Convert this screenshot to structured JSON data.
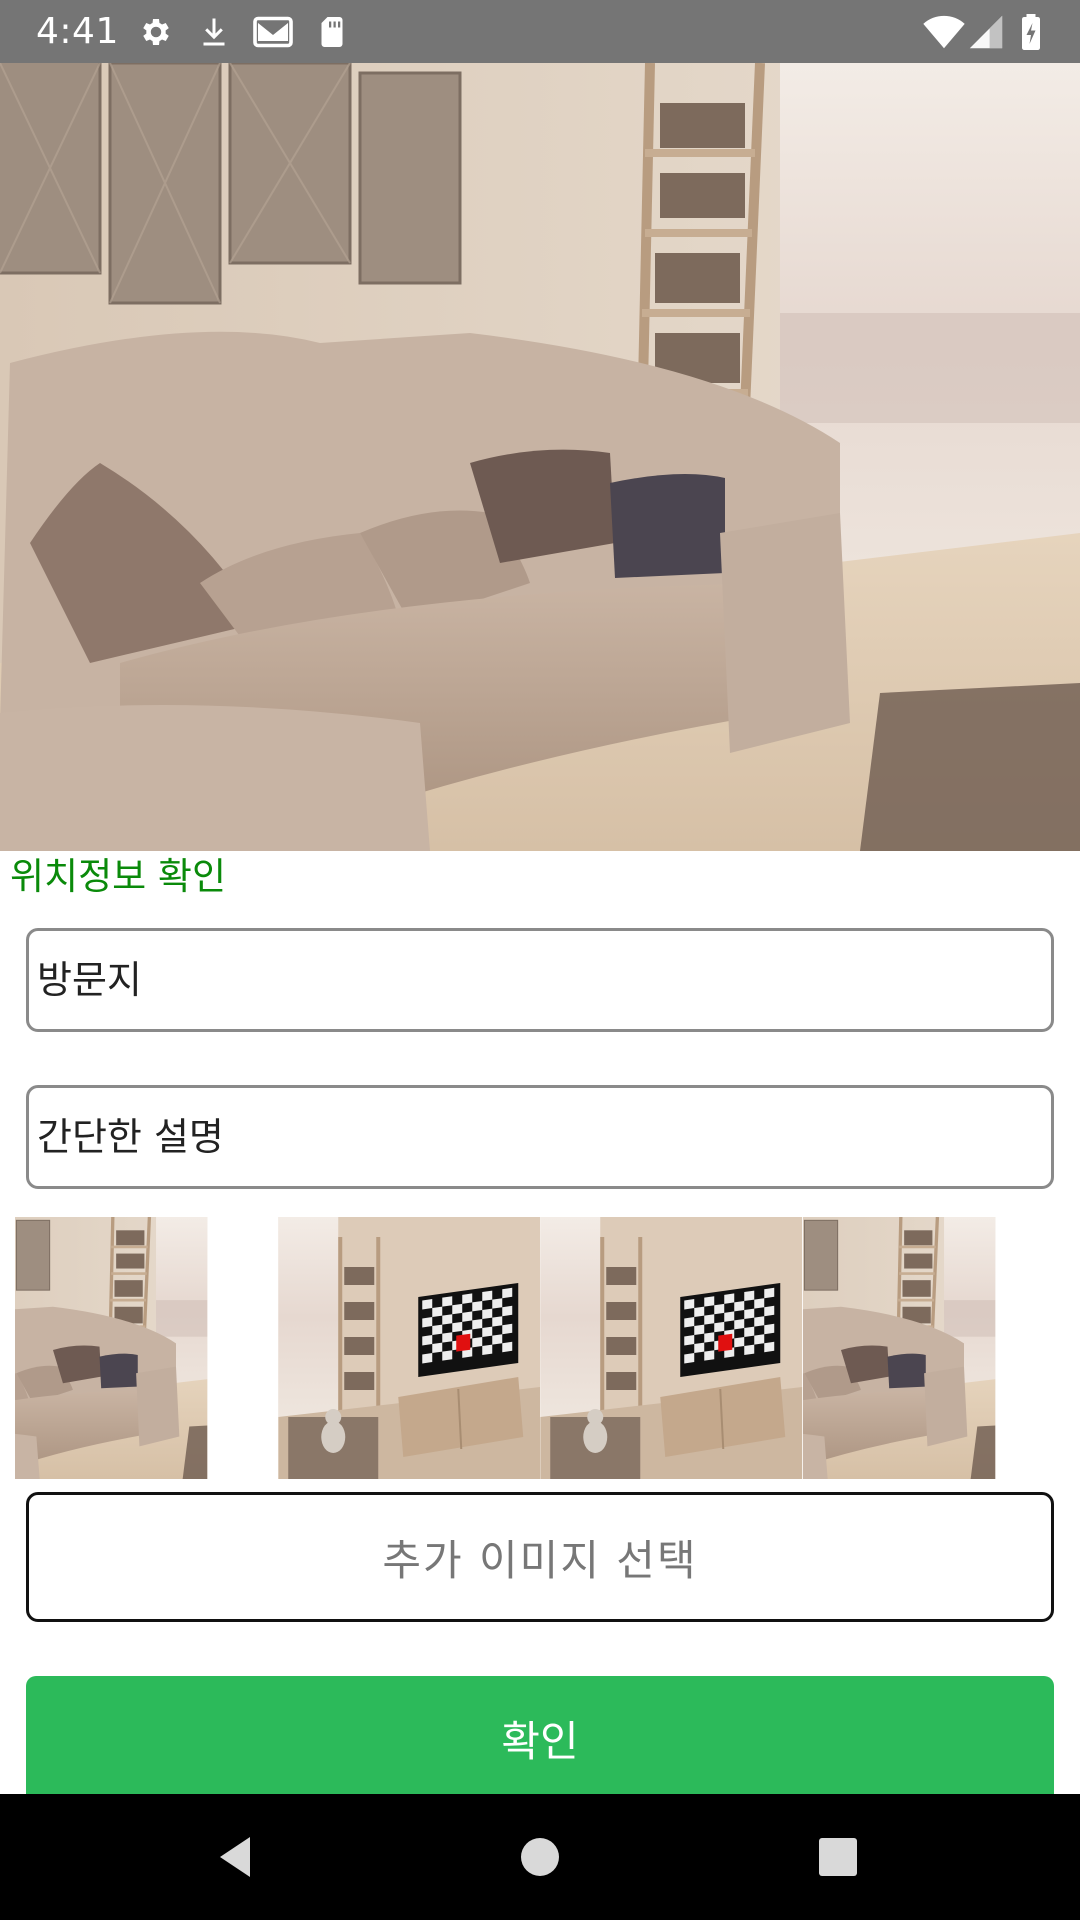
{
  "status_bar": {
    "time": "4:41",
    "left_icons": [
      "gear-icon",
      "download-icon",
      "gmail-icon",
      "sd-card-icon"
    ],
    "right_icons": [
      "wifi-icon",
      "signal-icon",
      "battery-icon"
    ]
  },
  "hero": {
    "image": "living-room-sofa-photo"
  },
  "location": {
    "label": "위치정보 확인",
    "color": "#0a8a0a"
  },
  "form": {
    "visit_placeholder": "방문지",
    "description_placeholder": "간단한 설명"
  },
  "thumbnails": [
    "living-room-sofa-photo",
    "living-room-tv-photo",
    "living-room-tv-photo",
    "living-room-sofa-photo"
  ],
  "buttons": {
    "add_image_label": "추가 이미지 선택",
    "confirm_label": "확인",
    "confirm_color": "#2cba5a"
  },
  "nav_bar": {
    "items": [
      "back-icon",
      "home-icon",
      "recents-icon"
    ]
  }
}
